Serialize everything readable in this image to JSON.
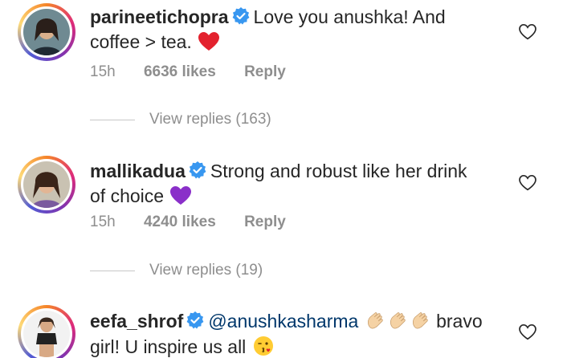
{
  "comments": [
    {
      "username": "parineetichopra",
      "verified": true,
      "text_line1": "Love you anushka! And",
      "text_line2": "coffee > tea.",
      "emoji": "red-heart",
      "time": "15h",
      "likes": "6636 likes",
      "reply": "Reply",
      "view_replies": "View replies (163)"
    },
    {
      "username": "mallikadua",
      "verified": true,
      "text_line1": "Strong and robust like her drink",
      "text_line2": "of choice",
      "emoji": "purple-heart",
      "time": "15h",
      "likes": "4240 likes",
      "reply": "Reply",
      "view_replies": "View replies (19)"
    },
    {
      "username": "eefa_shrof",
      "verified": true,
      "mention": "@anushkasharma",
      "text_line1_after": "bravo",
      "text_line2": "girl! U inspire us all",
      "emoji": "kissing-face",
      "emoji_inline": "clapping-hands"
    }
  ],
  "colors": {
    "text": "#262626",
    "muted": "#8e8e8e",
    "verified": "#3897f0",
    "mention": "#00376b"
  }
}
